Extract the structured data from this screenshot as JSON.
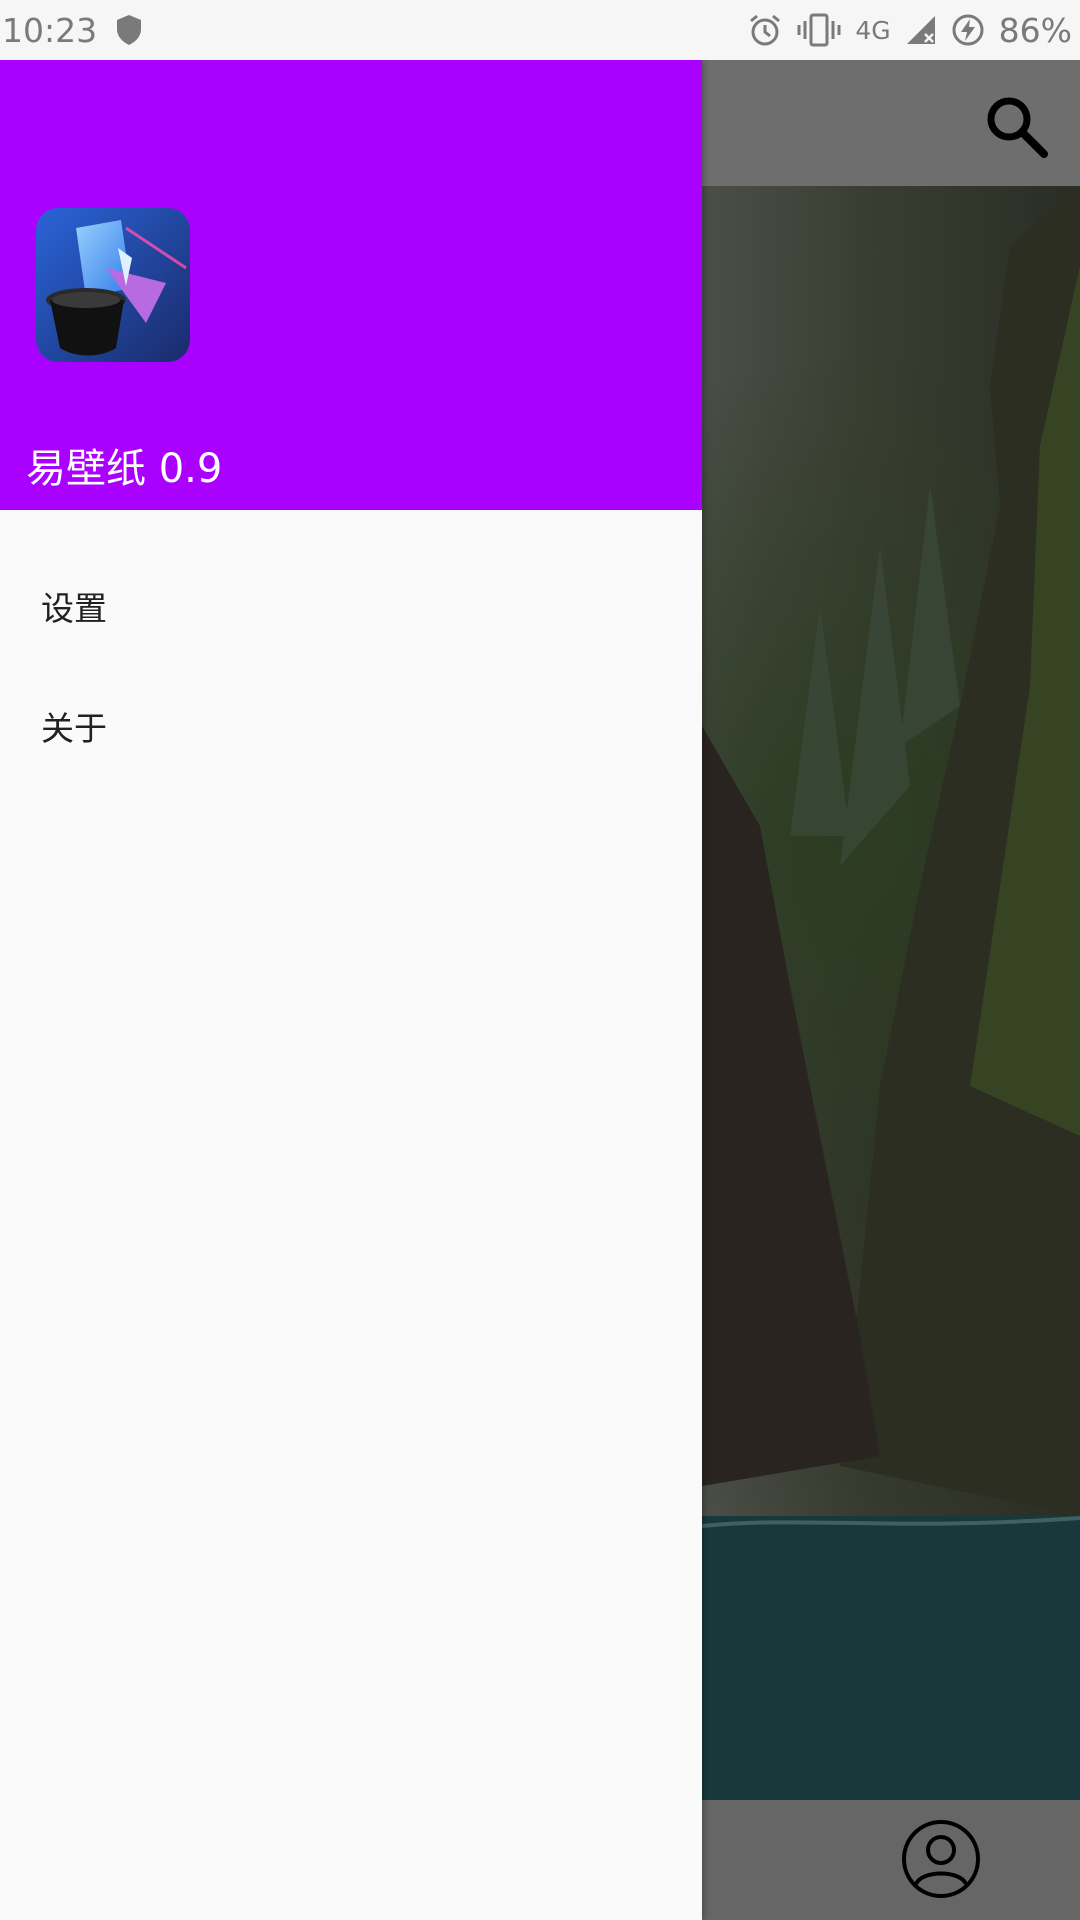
{
  "status_bar": {
    "time": "10:23",
    "network_label": "4G",
    "battery_percent": "86%"
  },
  "drawer": {
    "header_color": "#aa00ff",
    "app_title": "易壁纸 0.9",
    "menu_items": [
      {
        "label": "设置"
      },
      {
        "label": "关于"
      }
    ]
  },
  "icons": {
    "status": [
      "shield-icon",
      "alarm-icon",
      "vibrate-icon",
      "signal-icon",
      "battery-charging-icon"
    ],
    "toolbar": [
      "search-icon"
    ],
    "bottom_nav": [
      "profile-icon"
    ]
  }
}
